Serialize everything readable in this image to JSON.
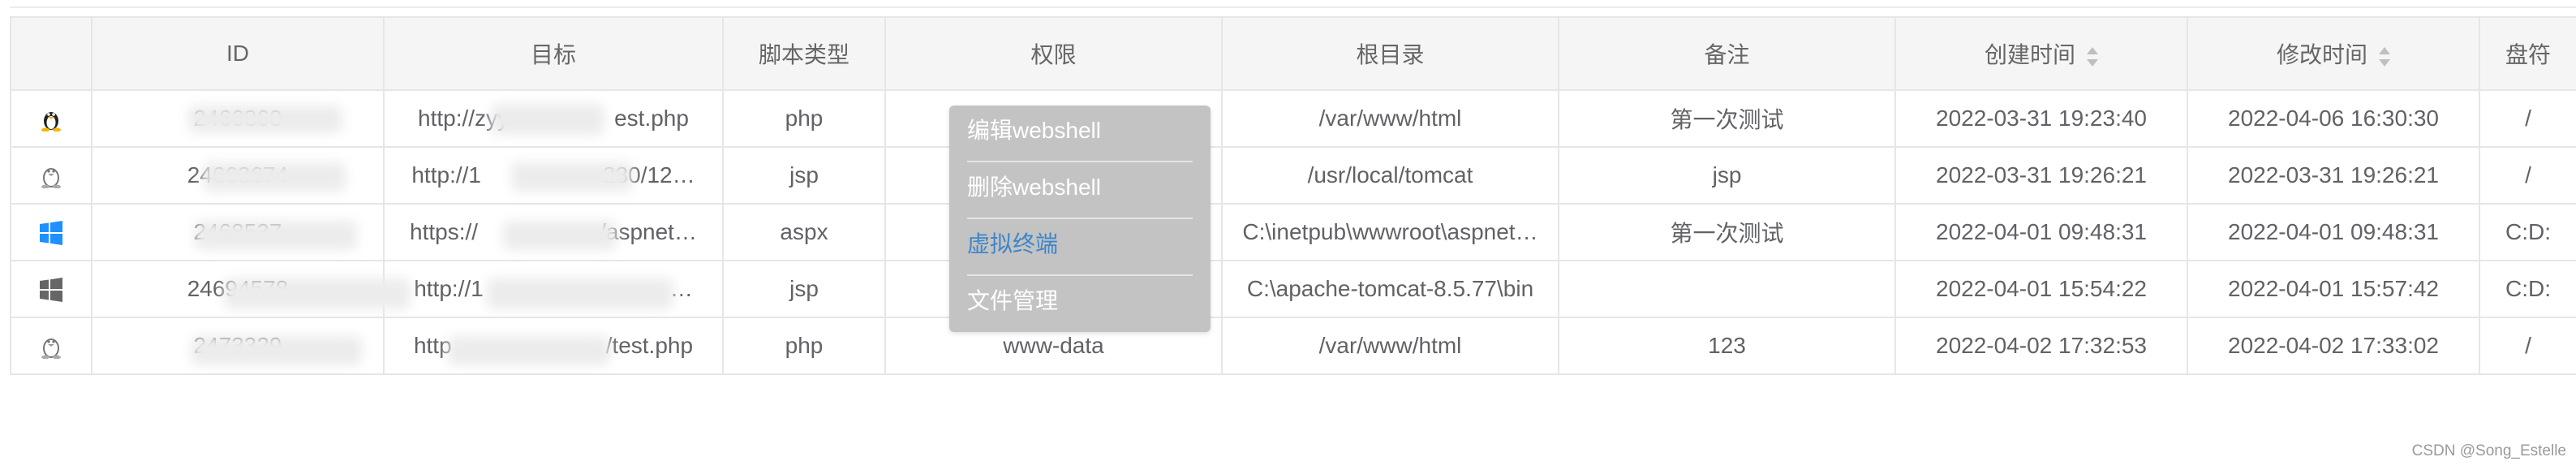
{
  "columns": [
    "",
    "ID",
    "目标",
    "脚本类型",
    "权限",
    "根目录",
    "备注",
    "创建时间",
    "修改时间",
    "盘符"
  ],
  "rows": [
    {
      "os": "linux-color",
      "id": "2466360",
      "target": "http://zyy",
      "target_tail": "est.php",
      "type": "php",
      "perm": "",
      "root": "/var/www/html",
      "note": "第一次测试",
      "created": "2022-03-31 19:23:40",
      "modified": "2022-04-06 16:30:30",
      "drive": "/"
    },
    {
      "os": "linux-gray",
      "id": "24663674",
      "target": "http://1",
      "target_tail": "280/12…",
      "type": "jsp",
      "perm": "",
      "root": "/usr/local/tomcat",
      "note": "jsp",
      "created": "2022-03-31 19:26:21",
      "modified": "2022-03-31 19:26:21",
      "drive": "/"
    },
    {
      "os": "windows-color",
      "id": "2468537",
      "target": "https://",
      "target_tail": "/aspnet…",
      "type": "aspx",
      "perm": "",
      "root": "C:\\inetpub\\wwwroot\\aspnet…",
      "note": "第一次测试",
      "created": "2022-04-01 09:48:31",
      "modified": "2022-04-01 09:48:31",
      "drive": "C:D:"
    },
    {
      "os": "windows-gray",
      "id": "24694578",
      "target": "http://1",
      "target_tail": "…",
      "type": "jsp",
      "perm": "",
      "root": "C:\\apache-tomcat-8.5.77\\bin",
      "note": "",
      "created": "2022-04-01 15:54:22",
      "modified": "2022-04-01 15:57:42",
      "drive": "C:D:"
    },
    {
      "os": "linux-gray",
      "id": "2473329",
      "target": "http",
      "target_tail": "/test.php",
      "type": "php",
      "perm": "www-data",
      "root": "/var/www/html",
      "note": "123",
      "created": "2022-04-02 17:32:53",
      "modified": "2022-04-02 17:33:02",
      "drive": "/"
    }
  ],
  "context_menu": {
    "items": [
      "编辑webshell",
      "删除webshell",
      "虚拟终端",
      "文件管理"
    ],
    "active_index": 2,
    "accent_color": "#3d86c8"
  },
  "watermark": "CSDN @Song_Estelle"
}
